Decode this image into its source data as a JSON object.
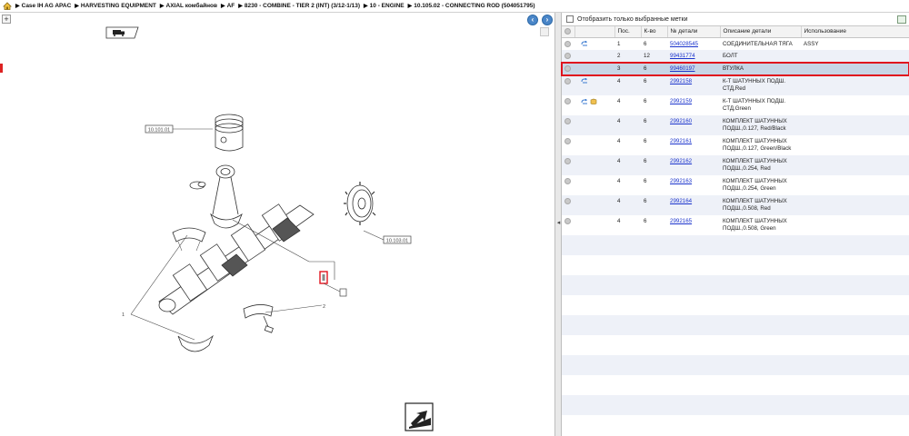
{
  "breadcrumb": [
    "Case IH AG APAC",
    "HARVESTING EQUIPMENT",
    "AXIAL комбайнов",
    "AF",
    "8230 - COMBINE - TIER 2 (INT) (3/12-1/13)",
    "10 - ENGINE",
    "10.105.02 - CONNECTING ROD (504051795)"
  ],
  "filter": {
    "label": "Отобразить только выбранные метки"
  },
  "columns": [
    "Пос.",
    "К-во",
    "№ детали",
    "Описание детали",
    "Использование"
  ],
  "rows": [
    {
      "pos": "1",
      "qty": "6",
      "part": "504028545",
      "desc1": "СОЕДИНИТЕЛЬНАЯ ТЯГА",
      "desc2": "",
      "usage": "ASSY",
      "icons": [
        "sub"
      ]
    },
    {
      "pos": "2",
      "qty": "12",
      "part": "99431774",
      "desc1": "БОЛТ",
      "desc2": "",
      "usage": "",
      "icons": []
    },
    {
      "pos": "3",
      "qty": "6",
      "part": "99460197",
      "desc1": "ВТУЛКА",
      "desc2": "",
      "usage": "",
      "icons": []
    },
    {
      "pos": "4",
      "qty": "6",
      "part": "2992158",
      "desc1": "К-Т ШАТУННЫХ ПОДШ.",
      "desc2": "СТД,Red",
      "usage": "",
      "icons": [
        "sub"
      ]
    },
    {
      "pos": "4",
      "qty": "6",
      "part": "2992159",
      "desc1": "К-Т ШАТУННЫХ ПОДШ.",
      "desc2": "СТД,Green",
      "usage": "",
      "icons": [
        "sub",
        "box"
      ]
    },
    {
      "pos": "4",
      "qty": "6",
      "part": "2992160",
      "desc1": "КОМПЛЕКТ ШАТУННЫХ",
      "desc2": "ПОДШ.,0.127, Red/Black",
      "usage": "",
      "icons": []
    },
    {
      "pos": "4",
      "qty": "6",
      "part": "2992161",
      "desc1": "КОМПЛЕКТ ШАТУННЫХ",
      "desc2": "ПОДШ.,0.127, Green/Black",
      "usage": "",
      "icons": []
    },
    {
      "pos": "4",
      "qty": "6",
      "part": "2992162",
      "desc1": "КОМПЛЕКТ ШАТУННЫХ",
      "desc2": "ПОДШ.,0.254, Red",
      "usage": "",
      "icons": []
    },
    {
      "pos": "4",
      "qty": "6",
      "part": "2992163",
      "desc1": "КОМПЛЕКТ ШАТУННЫХ",
      "desc2": "ПОДШ.,0.254, Green",
      "usage": "",
      "icons": []
    },
    {
      "pos": "4",
      "qty": "6",
      "part": "2992164",
      "desc1": "КОМПЛЕКТ ШАТУННЫХ",
      "desc2": "ПОДШ.,0.508, Red",
      "usage": "",
      "icons": []
    },
    {
      "pos": "4",
      "qty": "6",
      "part": "2992165",
      "desc1": "КОМПЛЕКТ ШАТУННЫХ",
      "desc2": "ПОДШ.,0.508, Green",
      "usage": "",
      "icons": []
    }
  ],
  "selected_row": 2,
  "drawing": {
    "callouts": [
      "10.101.01",
      "10.103.01",
      "1",
      "2",
      "3"
    ]
  },
  "colors": {
    "selection_outline": "#e0141e",
    "link": "#1a33cc",
    "nav_button": "#4a86c8",
    "alt_row": "#eef1f8",
    "selected_row": "#c8d6e6"
  }
}
